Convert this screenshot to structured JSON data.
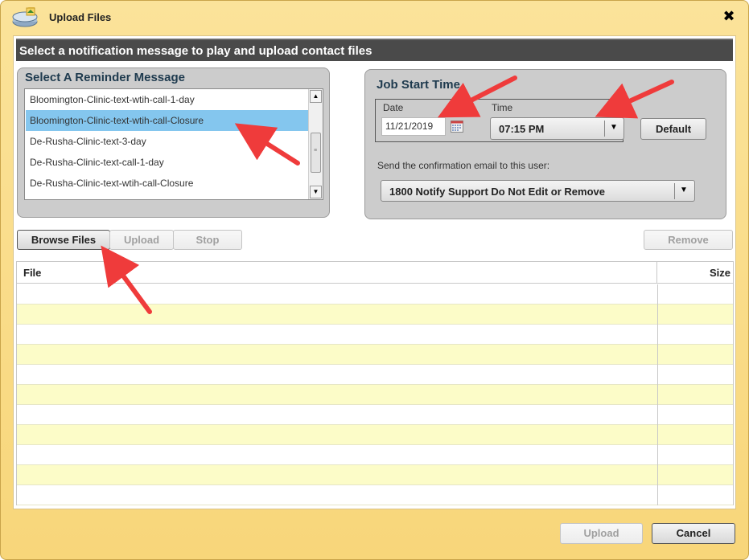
{
  "window": {
    "title": "Upload Files",
    "close_glyph": "✖",
    "title_icon": "upload-files-icon"
  },
  "header": {
    "text": "Select a notification message to play and upload contact files"
  },
  "reminder": {
    "title": "Select A Reminder Message",
    "items": [
      {
        "label": "Bloomington-Clinic-text-wtih-call-1-day",
        "selected": false
      },
      {
        "label": "Bloomington-Clinic-text-wtih-call-Closure",
        "selected": true
      },
      {
        "label": "De-Rusha-Clinic-text-3-day",
        "selected": false
      },
      {
        "label": "De-Rusha-Clinic-text-call-1-day",
        "selected": false
      },
      {
        "label": "De-Rusha-Clinic-text-wtih-call-Closure",
        "selected": false
      }
    ]
  },
  "job": {
    "title": "Job Start Time",
    "date_label": "Date",
    "date_value": "11/21/2019",
    "time_label": "Time",
    "time_value": "07:15 PM",
    "default_button": "Default",
    "email_label": "Send the confirmation email to this user:",
    "email_user": "1800 Notify Support Do Not Edit or Remove"
  },
  "toolbar": {
    "browse": "Browse Files",
    "upload": "Upload",
    "stop": "Stop",
    "remove": "Remove"
  },
  "table": {
    "columns": [
      "File",
      "Size"
    ],
    "rows": []
  },
  "footer": {
    "upload": "Upload",
    "cancel": "Cancel"
  },
  "colors": {
    "window_bg": "#f8d67a",
    "header_bg": "#4a4a4a",
    "selected_row": "#84c6ee",
    "alt_row": "#fcfcc8",
    "annotation_arrow": "#ef3b3b"
  }
}
